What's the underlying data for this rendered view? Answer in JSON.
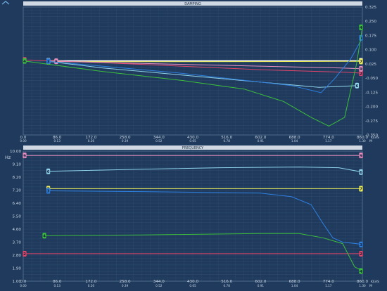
{
  "colors": {
    "background": "#1f3a5c",
    "grid": "#5a7796",
    "axis_text": "#c9d6e4",
    "title_bar": "#cfd8e3",
    "title_text": "#1a2a3c"
  },
  "chart_data": [
    {
      "type": "line",
      "title": "DAMPING",
      "x_tick_labels": [
        "0.0",
        "86.0",
        "172.0",
        "258.0",
        "344.0",
        "430.0",
        "516.0",
        "602.0",
        "688.0",
        "774.0",
        "860.0"
      ],
      "mach_tick_labels": [
        "0.00",
        "0.13",
        "0.26",
        "0.39",
        "0.52",
        "0.65",
        "0.78",
        "0.91",
        "1.04",
        "1.17",
        "1.30"
      ],
      "x_unit_label": "KEAS",
      "mach_unit_label": "M",
      "y_tick_labels": [
        "0.325",
        "0.250",
        "0.175",
        "0.100",
        "0.025",
        "-0.050",
        "-0.125",
        "-0.200",
        "-0.275",
        "-0.350"
      ],
      "xlim": [
        0,
        860
      ],
      "ylim": [
        -0.4,
        0.325
      ],
      "grid": true,
      "series": [
        {
          "color": "#ffffff",
          "marker": "8",
          "x": [
            60,
            200,
            400,
            600,
            790,
            860
          ],
          "y": [
            0.02,
            0.02,
            0.02,
            0.02,
            0.02,
            0.02
          ]
        },
        {
          "color": "#f2f05a",
          "marker": "7",
          "x": [
            60,
            300,
            600,
            800,
            860
          ],
          "y": [
            0.015,
            0.015,
            0.016,
            0.017,
            0.017
          ]
        },
        {
          "color": "#e0456a",
          "marker": "2",
          "x": [
            0,
            200,
            400,
            600,
            820,
            860
          ],
          "y": [
            0.025,
            0.01,
            -0.01,
            -0.03,
            -0.045,
            -0.05
          ]
        },
        {
          "color": "#ec8fc0",
          "marker": "9",
          "x": [
            80,
            300,
            600,
            800,
            860
          ],
          "y": [
            0.018,
            0.005,
            -0.01,
            -0.02,
            -0.025
          ]
        },
        {
          "color": "#8fd4ec",
          "marker": "6",
          "x": [
            60,
            200,
            400,
            600,
            750,
            850
          ],
          "y": [
            0.018,
            -0.02,
            -0.06,
            -0.1,
            -0.13,
            -0.12
          ]
        },
        {
          "color": "#2e7fe0",
          "marker": "3",
          "x": [
            60,
            200,
            400,
            560,
            680,
            755,
            790,
            830,
            860
          ],
          "y": [
            0.018,
            -0.01,
            -0.05,
            -0.09,
            -0.12,
            -0.16,
            -0.08,
            0.03,
            0.15
          ]
        },
        {
          "color": "#3cbf3c",
          "marker": "4",
          "x": [
            0,
            200,
            400,
            560,
            660,
            730,
            775,
            815,
            845,
            860
          ],
          "y": [
            0.02,
            -0.04,
            -0.09,
            -0.14,
            -0.21,
            -0.3,
            -0.35,
            -0.3,
            0.0,
            0.21
          ]
        }
      ]
    },
    {
      "type": "line",
      "title": "FREQUENCY",
      "y_unit_label": "Hz",
      "x_tick_labels": [
        "0.0",
        "86.0",
        "172.0",
        "258.0",
        "344.0",
        "430.0",
        "516.0",
        "602.0",
        "688.0",
        "774.0",
        "860.0"
      ],
      "mach_tick_labels": [
        "0.00",
        "0.13",
        "0.26",
        "0.39",
        "0.52",
        "0.65",
        "0.78",
        "0.91",
        "1.04",
        "1.17",
        "1.30"
      ],
      "x_unit_label": "KEAS",
      "mach_unit_label": "M",
      "y_tick_labels": [
        "10.00",
        "9.10",
        "8.20",
        "7.30",
        "6.40",
        "5.50",
        "4.60",
        "3.70",
        "2.80",
        "1.90",
        "1.00"
      ],
      "xlim": [
        0,
        860
      ],
      "ylim": [
        1.0,
        10.0
      ],
      "grid": true,
      "series": [
        {
          "color": "#e0456a",
          "marker": "2",
          "x": [
            0,
            860
          ],
          "y": [
            2.9,
            2.9
          ]
        },
        {
          "color": "#ec8fc0",
          "marker": "9",
          "x": [
            0,
            860
          ],
          "y": [
            9.7,
            9.7
          ]
        },
        {
          "color": "#8fd4ec",
          "marker": "6",
          "x": [
            60,
            300,
            500,
            700,
            800,
            860
          ],
          "y": [
            8.6,
            8.75,
            8.85,
            8.9,
            8.85,
            8.55
          ]
        },
        {
          "color": "#f2f05a",
          "marker": "7",
          "x": [
            60,
            860
          ],
          "y": [
            7.4,
            7.4
          ]
        },
        {
          "color": "#2e7fe0",
          "marker": "3",
          "x": [
            60,
            300,
            600,
            680,
            730,
            760,
            785,
            810,
            860
          ],
          "y": [
            7.25,
            7.2,
            7.1,
            6.85,
            6.3,
            5.0,
            4.0,
            3.7,
            3.55
          ]
        },
        {
          "color": "#3cbf3c",
          "marker": "4",
          "x": [
            50,
            300,
            600,
            700,
            760,
            810,
            840,
            860
          ],
          "y": [
            4.15,
            4.2,
            4.3,
            4.3,
            4.0,
            3.6,
            2.0,
            1.7
          ]
        }
      ]
    }
  ]
}
